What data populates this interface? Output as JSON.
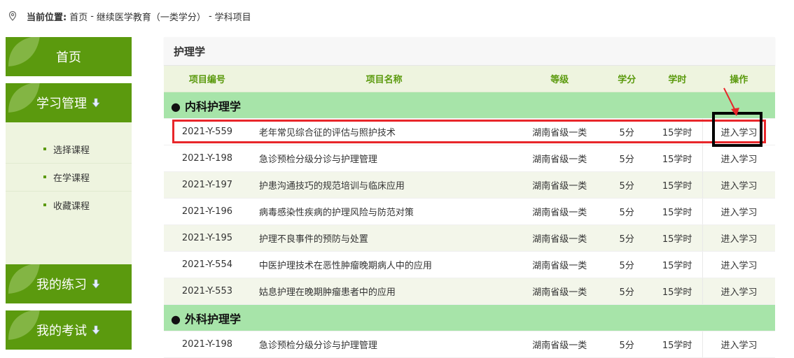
{
  "breadcrumb": {
    "label": "当前位置:",
    "home": "首页",
    "sep": "-",
    "section": "继续医学教育（一类学分）",
    "current": "学科项目"
  },
  "sidebar": {
    "home": "首页",
    "study": "学习管理",
    "submenu": [
      "选择课程",
      "在学课程",
      "收藏课程"
    ],
    "practice": "我的练习",
    "exam": "我的考试"
  },
  "panel": {
    "title": "护理学"
  },
  "table": {
    "headers": [
      "项目编号",
      "项目名称",
      "等级",
      "学分",
      "学时",
      "操作"
    ],
    "groups": [
      {
        "name": "内科护理学",
        "rows": [
          {
            "code": "2021-Y-559",
            "name": "老年常见综合征的评估与照护技术",
            "level": "湖南省级一类",
            "credit": "5分",
            "hours": "15学时",
            "op": "进入学习"
          },
          {
            "code": "2021-Y-198",
            "name": "急诊预检分级分诊与护理管理",
            "level": "湖南省级一类",
            "credit": "5分",
            "hours": "15学时",
            "op": "进入学习"
          },
          {
            "code": "2021-Y-197",
            "name": "护患沟通技巧的规范培训与临床应用",
            "level": "湖南省级一类",
            "credit": "5分",
            "hours": "15学时",
            "op": "进入学习"
          },
          {
            "code": "2021-Y-196",
            "name": "病毒感染性疾病的护理风险与防范对策",
            "level": "湖南省级一类",
            "credit": "5分",
            "hours": "15学时",
            "op": "进入学习"
          },
          {
            "code": "2021-Y-195",
            "name": "护理不良事件的预防与处置",
            "level": "湖南省级一类",
            "credit": "5分",
            "hours": "15学时",
            "op": "进入学习"
          },
          {
            "code": "2021-Y-554",
            "name": "中医护理技术在恶性肿瘤晚期病人中的应用",
            "level": "湖南省级一类",
            "credit": "5分",
            "hours": "15学时",
            "op": "进入学习"
          },
          {
            "code": "2021-Y-553",
            "name": "姑息护理在晚期肿瘤患者中的应用",
            "level": "湖南省级一类",
            "credit": "5分",
            "hours": "15学时",
            "op": "进入学习"
          }
        ]
      },
      {
        "name": "外科护理学",
        "rows": [
          {
            "code": "2021-Y-198",
            "name": "急诊预检分级分诊与护理管理",
            "level": "湖南省级一类",
            "credit": "5分",
            "hours": "15学时",
            "op": "进入学习"
          }
        ]
      }
    ]
  },
  "colors": {
    "brand_green": "#5b9a0e",
    "group_green": "#a7e4a9",
    "highlight_red": "#e8262a"
  },
  "icons": {
    "breadcrumb": "location-pin-icon",
    "expand": "down-arrow-icon",
    "leaf": "leaf-icon"
  }
}
